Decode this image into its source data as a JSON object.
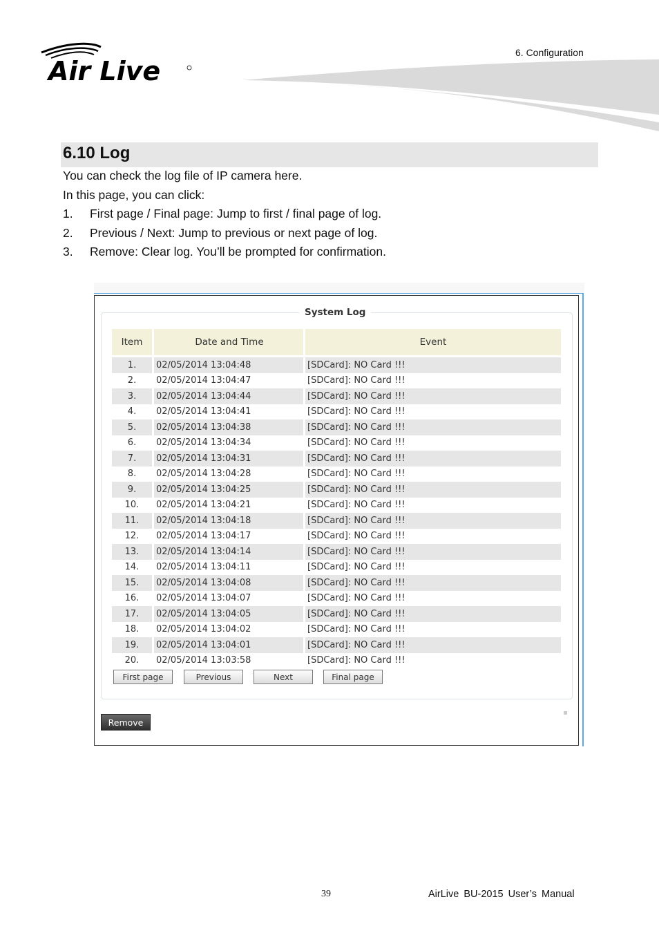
{
  "header": {
    "logo_text": "Air Live",
    "chapter": "6.  Configuration"
  },
  "section": {
    "title": "6.10 Log",
    "intro": "You can check the log file of IP camera here.",
    "intro2": "In this page, you can click:",
    "items": [
      {
        "num": "1.",
        "text": "First page / Final page: Jump to first / final page of log."
      },
      {
        "num": "2.",
        "text": "Previous / Next: Jump to previous or next page of log."
      },
      {
        "num": "3.",
        "text": "Remove: Clear log. You’ll be prompted for confirmation."
      }
    ]
  },
  "system_log": {
    "title": "System Log",
    "columns": [
      "Item",
      "Date and Time",
      "Event"
    ],
    "rows": [
      {
        "item": "1.",
        "datetime": "02/05/2014 13:04:48",
        "event": "[SDCard]: NO Card !!!"
      },
      {
        "item": "2.",
        "datetime": "02/05/2014 13:04:47",
        "event": "[SDCard]: NO Card !!!"
      },
      {
        "item": "3.",
        "datetime": "02/05/2014 13:04:44",
        "event": "[SDCard]: NO Card !!!"
      },
      {
        "item": "4.",
        "datetime": "02/05/2014 13:04:41",
        "event": "[SDCard]: NO Card !!!"
      },
      {
        "item": "5.",
        "datetime": "02/05/2014 13:04:38",
        "event": "[SDCard]: NO Card !!!"
      },
      {
        "item": "6.",
        "datetime": "02/05/2014 13:04:34",
        "event": "[SDCard]: NO Card !!!"
      },
      {
        "item": "7.",
        "datetime": "02/05/2014 13:04:31",
        "event": "[SDCard]: NO Card !!!"
      },
      {
        "item": "8.",
        "datetime": "02/05/2014 13:04:28",
        "event": "[SDCard]: NO Card !!!"
      },
      {
        "item": "9.",
        "datetime": "02/05/2014 13:04:25",
        "event": "[SDCard]: NO Card !!!"
      },
      {
        "item": "10.",
        "datetime": "02/05/2014 13:04:21",
        "event": "[SDCard]: NO Card !!!"
      },
      {
        "item": "11.",
        "datetime": "02/05/2014 13:04:18",
        "event": "[SDCard]: NO Card !!!"
      },
      {
        "item": "12.",
        "datetime": "02/05/2014 13:04:17",
        "event": "[SDCard]: NO Card !!!"
      },
      {
        "item": "13.",
        "datetime": "02/05/2014 13:04:14",
        "event": "[SDCard]: NO Card !!!"
      },
      {
        "item": "14.",
        "datetime": "02/05/2014 13:04:11",
        "event": "[SDCard]: NO Card !!!"
      },
      {
        "item": "15.",
        "datetime": "02/05/2014 13:04:08",
        "event": "[SDCard]: NO Card !!!"
      },
      {
        "item": "16.",
        "datetime": "02/05/2014 13:04:07",
        "event": "[SDCard]: NO Card !!!"
      },
      {
        "item": "17.",
        "datetime": "02/05/2014 13:04:05",
        "event": "[SDCard]: NO Card !!!"
      },
      {
        "item": "18.",
        "datetime": "02/05/2014 13:04:02",
        "event": "[SDCard]: NO Card !!!"
      },
      {
        "item": "19.",
        "datetime": "02/05/2014 13:04:01",
        "event": "[SDCard]: NO Card !!!"
      },
      {
        "item": "20.",
        "datetime": "02/05/2014 13:03:58",
        "event": "[SDCard]: NO Card !!!"
      }
    ],
    "buttons": {
      "first": "First page",
      "previous": "Previous",
      "next": "Next",
      "final": "Final page",
      "remove": "Remove"
    }
  },
  "footer": {
    "page_number": "39",
    "manual_title": "AirLive  BU-2015  User’s  Manual"
  }
}
